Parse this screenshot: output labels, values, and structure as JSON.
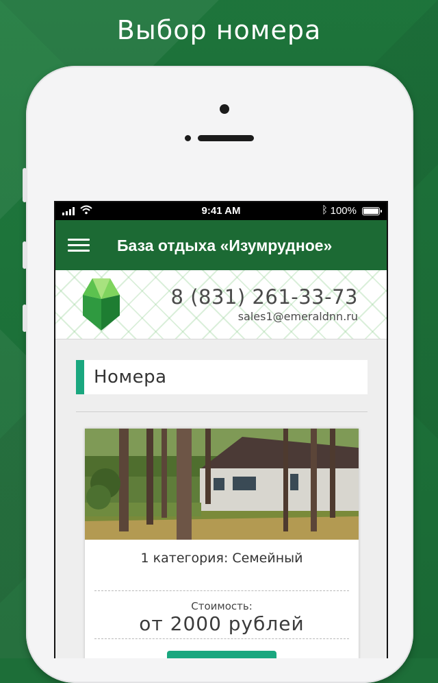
{
  "promo": {
    "title": "Выбор номера"
  },
  "status_bar": {
    "time": "9:41 AM",
    "battery": "100%"
  },
  "app_bar": {
    "title": "База отдыха «Изумрудное»"
  },
  "header": {
    "phone": "8 (831) 261-33-73",
    "email": "sales1@emeraldnn.ru"
  },
  "section": {
    "title": "Номера"
  },
  "rooms": [
    {
      "name": "1 категория: Семейный",
      "price_label": "Стоимость:",
      "price": "от 2000 рублей",
      "button": ""
    }
  ],
  "colors": {
    "background": "#1d6e38",
    "app_bar": "#1c6a34",
    "accent": "#1aa77f"
  },
  "icons": [
    "hamburger-menu-icon",
    "signal-icon",
    "wifi-icon",
    "bluetooth-icon",
    "battery-icon",
    "emerald-logo"
  ]
}
